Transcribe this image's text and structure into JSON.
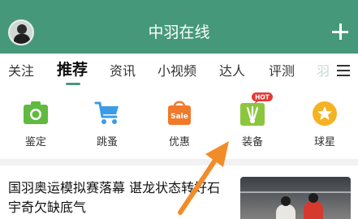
{
  "header": {
    "title": "中羽在线",
    "background": "#45997a"
  },
  "tabs": {
    "items": [
      {
        "label": "关注"
      },
      {
        "label": "推荐",
        "active": true
      },
      {
        "label": "资讯"
      },
      {
        "label": "小视频"
      },
      {
        "label": "达人"
      },
      {
        "label": "评测"
      },
      {
        "label": "羽"
      }
    ],
    "accent": "#45997a"
  },
  "quick_icons": [
    {
      "label": "鉴定",
      "icon": "camera-icon",
      "color": "#5fba3f"
    },
    {
      "label": "跳蚤",
      "icon": "shopping-cart-icon",
      "color": "#3b9be6"
    },
    {
      "label": "优惠",
      "icon": "sale-bag-icon",
      "color": "#f07a2a",
      "badge_text": "Sale"
    },
    {
      "label": "装备",
      "icon": "shuttlecock-icon",
      "color": "#8cc63f",
      "badge": "HOT",
      "badge_color": "#e53935"
    },
    {
      "label": "球星",
      "icon": "star-icon",
      "color": "#f5b321"
    }
  ],
  "article": {
    "headline": "国羽奥运模拟赛落幕 谌龙状态转好石宇奇欠缺底气"
  },
  "annotation": {
    "arrow_color": "#f28c28"
  }
}
